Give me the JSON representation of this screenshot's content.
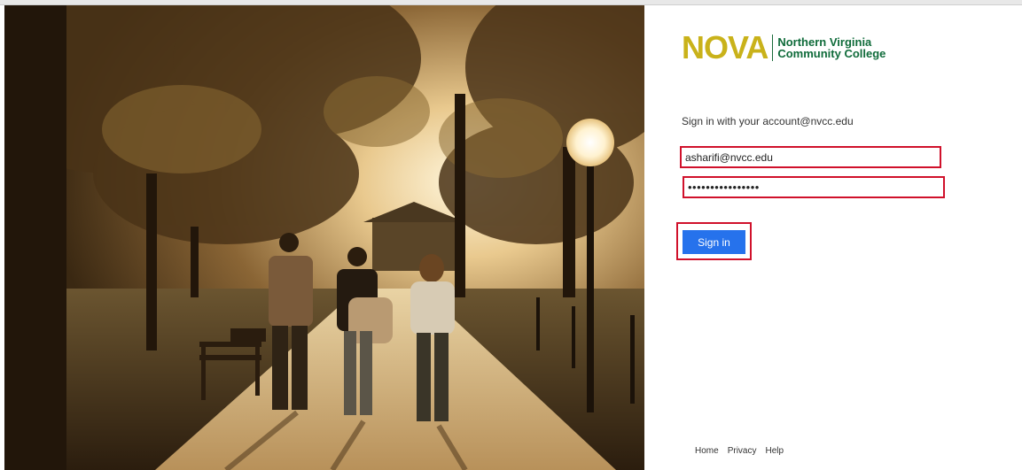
{
  "brand": {
    "name": "NOVA",
    "line1": "Northern Virginia",
    "line2": "Community College",
    "nova_color": "#c9b21a",
    "text_color": "#0f6b3a"
  },
  "signin": {
    "prompt": "Sign in with your account@nvcc.edu",
    "email_value": "asharifi@nvcc.edu",
    "password_value": "••••••••••••••••",
    "button_label": "Sign in",
    "button_color": "#2672ec",
    "highlight_color": "#d0112b"
  },
  "footer": {
    "links": [
      "Home",
      "Privacy",
      "Help"
    ]
  },
  "background": {
    "icon": "campus-photo"
  }
}
